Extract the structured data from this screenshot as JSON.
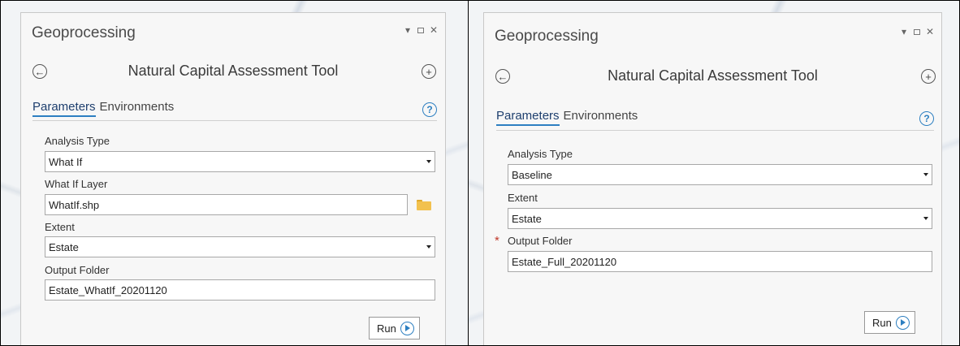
{
  "left_panel": {
    "pane_title": "Geoprocessing",
    "tool_title": "Natural Capital Assessment Tool",
    "tabs": [
      "Parameters",
      "Environments"
    ],
    "help_label": "?",
    "analysis_type": {
      "label": "Analysis Type",
      "value": "What If"
    },
    "what_if_layer": {
      "label": "What If Layer",
      "value": "WhatIf.shp"
    },
    "extent": {
      "label": "Extent",
      "value": "Estate"
    },
    "output_folder": {
      "label": "Output Folder",
      "value": "Estate_WhatIf_20201120"
    },
    "run_label": "Run"
  },
  "right_panel": {
    "pane_title": "Geoprocessing",
    "tool_title": "Natural Capital Assessment Tool",
    "tabs": [
      "Parameters",
      "Environments"
    ],
    "help_label": "?",
    "analysis_type": {
      "label": "Analysis Type",
      "value": "Baseline"
    },
    "extent": {
      "label": "Extent",
      "value": "Estate"
    },
    "output_folder": {
      "label": "Output Folder",
      "value": "Estate_Full_20201120",
      "required_marker": "*"
    },
    "run_label": "Run"
  },
  "icons": {
    "back": "back-arrow-icon",
    "add": "add-icon",
    "help": "help-icon",
    "folder": "folder-icon",
    "run": "run-play-icon",
    "menu": "menu-dropdown-icon",
    "maximize": "maximize-icon",
    "close": "close-icon"
  },
  "colors": {
    "accent": "#2d7fc1",
    "required": "#c0392b",
    "folder": "#f2c14e"
  }
}
